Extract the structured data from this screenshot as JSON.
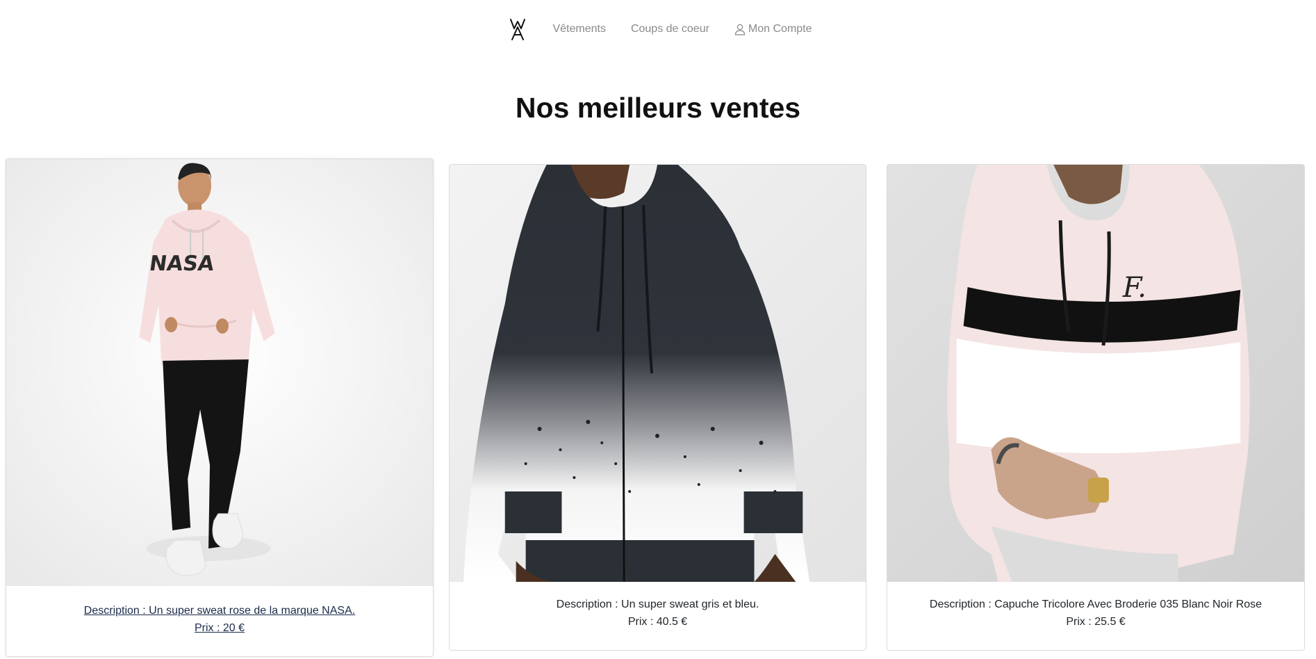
{
  "nav": {
    "logo_label": "WA",
    "links": [
      {
        "label": "Vêtements"
      },
      {
        "label": "Coups de coeur"
      },
      {
        "label": "Mon Compte",
        "icon": "user-icon"
      }
    ]
  },
  "page_title": "Nos meilleurs ventes",
  "products": [
    {
      "description": "Description : Un super sweat rose de la marque NASA.",
      "price": "Prix : 20 €",
      "image": "man-pink-nasa-hoodie"
    },
    {
      "description": "Description : Un super sweat gris et bleu.",
      "price": "Prix : 40.5 €",
      "image": "dark-zip-hoodie-white-splatter"
    },
    {
      "description": "Description : Capuche Tricolore Avec Broderie 035 Blanc Noir Rose",
      "price": "Prix : 25.5 €",
      "image": "pink-white-black-stripe-hoodie"
    }
  ],
  "colors": {
    "nav_text": "#8a8a8a",
    "title": "#111111",
    "card_border": "rgba(0,0,0,0.14)"
  }
}
